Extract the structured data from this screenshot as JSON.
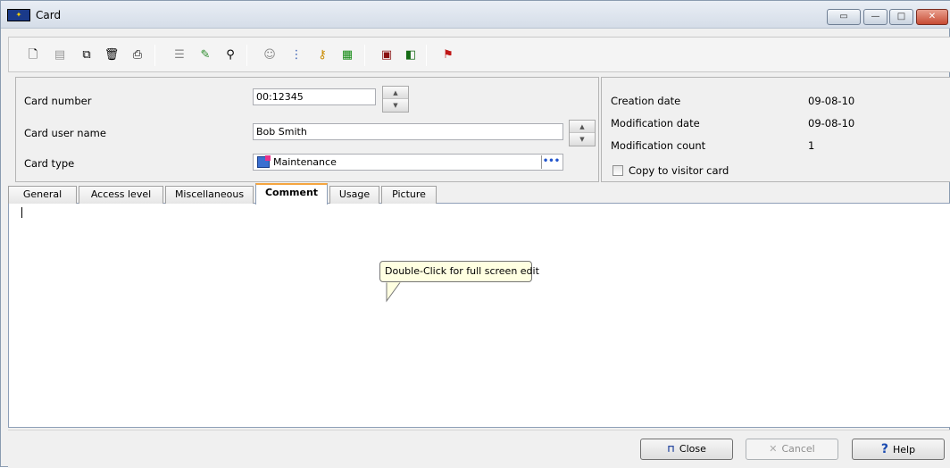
{
  "window": {
    "title": "Card",
    "icon": "app-logo-icon"
  },
  "toolbar": {
    "buttons": [
      {
        "name": "new-icon",
        "glyph": "🗋"
      },
      {
        "name": "save-icon",
        "glyph": "💾"
      },
      {
        "name": "copy-icon",
        "glyph": "⧉"
      },
      {
        "name": "delete-icon",
        "glyph": "🗑"
      },
      {
        "name": "print-icon",
        "glyph": "⎙"
      },
      {
        "name": "list-icon",
        "glyph": "☰"
      },
      {
        "name": "link-icon",
        "glyph": "✎"
      },
      {
        "name": "find-icon",
        "glyph": "🔭"
      },
      {
        "name": "users-icon",
        "glyph": "☺"
      },
      {
        "name": "tree-icon",
        "glyph": "⋮"
      },
      {
        "name": "key-icon",
        "glyph": "🔑"
      },
      {
        "name": "grid-icon",
        "glyph": "▦"
      },
      {
        "name": "film-icon",
        "glyph": "▣"
      },
      {
        "name": "layers-icon",
        "glyph": "◧"
      },
      {
        "name": "card-print-icon",
        "glyph": "⚑"
      }
    ]
  },
  "form": {
    "card_number_label": "Card number",
    "card_number_value": "00:12345",
    "card_user_label": "Card user name",
    "card_user_value": "Bob Smith",
    "card_type_label": "Card type",
    "card_type_value": "Maintenance",
    "ellipsis": "•••"
  },
  "info": {
    "creation_label": "Creation date",
    "creation_value": "09-08-10",
    "modification_label": "Modification date",
    "modification_value": "09-08-10",
    "count_label": "Modification count",
    "count_value": "1",
    "copy_visitor_label": "Copy to visitor card",
    "copy_visitor_checked": false
  },
  "tabs": {
    "general": "General",
    "access_level": "Access level",
    "misc": "Miscellaneous",
    "comment": "Comment",
    "usage": "Usage",
    "picture": "Picture",
    "active": "Comment"
  },
  "editor": {
    "tooltip": "Double-Click for full screen edit"
  },
  "buttons": {
    "close": "Close",
    "cancel": "Cancel",
    "help": "Help"
  },
  "colors": {
    "accent_tab": "#f5a540",
    "tooltip_bg": "#ffffe1"
  }
}
